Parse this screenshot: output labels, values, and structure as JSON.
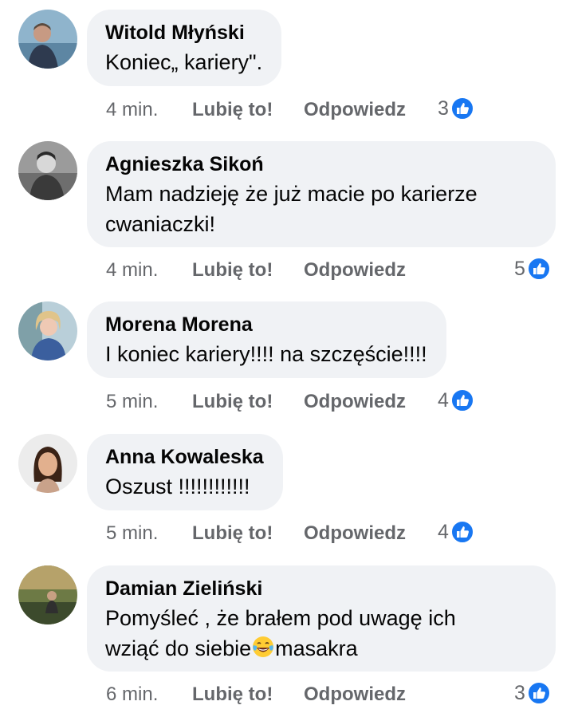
{
  "actions": {
    "like_label": "Lubię to!",
    "reply_label": "Odpowiedz"
  },
  "colors": {
    "bubble": "#f0f2f5",
    "meta": "#65676b",
    "like_blue": "#1877f2"
  },
  "comments": [
    {
      "author": "Witold Młyński",
      "lines": [
        "Koniec„ kariery\"."
      ],
      "time": "4 min.",
      "reactions": "3",
      "avatar_icon": "man-photo-avatar"
    },
    {
      "author": "Agnieszka Sikoń",
      "lines": [
        "Mam nadzieję że już macie po karierze",
        "cwaniaczki!"
      ],
      "time": "4 min.",
      "reactions": "5",
      "avatar_icon": "child-photo-avatar"
    },
    {
      "author": "Morena Morena",
      "lines": [
        "I koniec kariery!!!! na szczęście!!!!"
      ],
      "time": "5 min.",
      "reactions": "4",
      "avatar_icon": "woman-photo-avatar"
    },
    {
      "author": "Anna Kowaleska",
      "lines": [
        "Oszust !!!!!!!!!!!!"
      ],
      "time": "5 min.",
      "reactions": "4",
      "avatar_icon": "woman-illustration-avatar"
    },
    {
      "author": "Damian Zieliński",
      "lines": [
        "Pomyśleć , że brałem pod uwagę ich",
        "wziąć do siebie",
        "masakra"
      ],
      "time": "6 min.",
      "reactions": "3",
      "avatar_icon": "outdoor-photo-avatar",
      "emoji_icon": "tears-of-joy-emoji"
    }
  ]
}
